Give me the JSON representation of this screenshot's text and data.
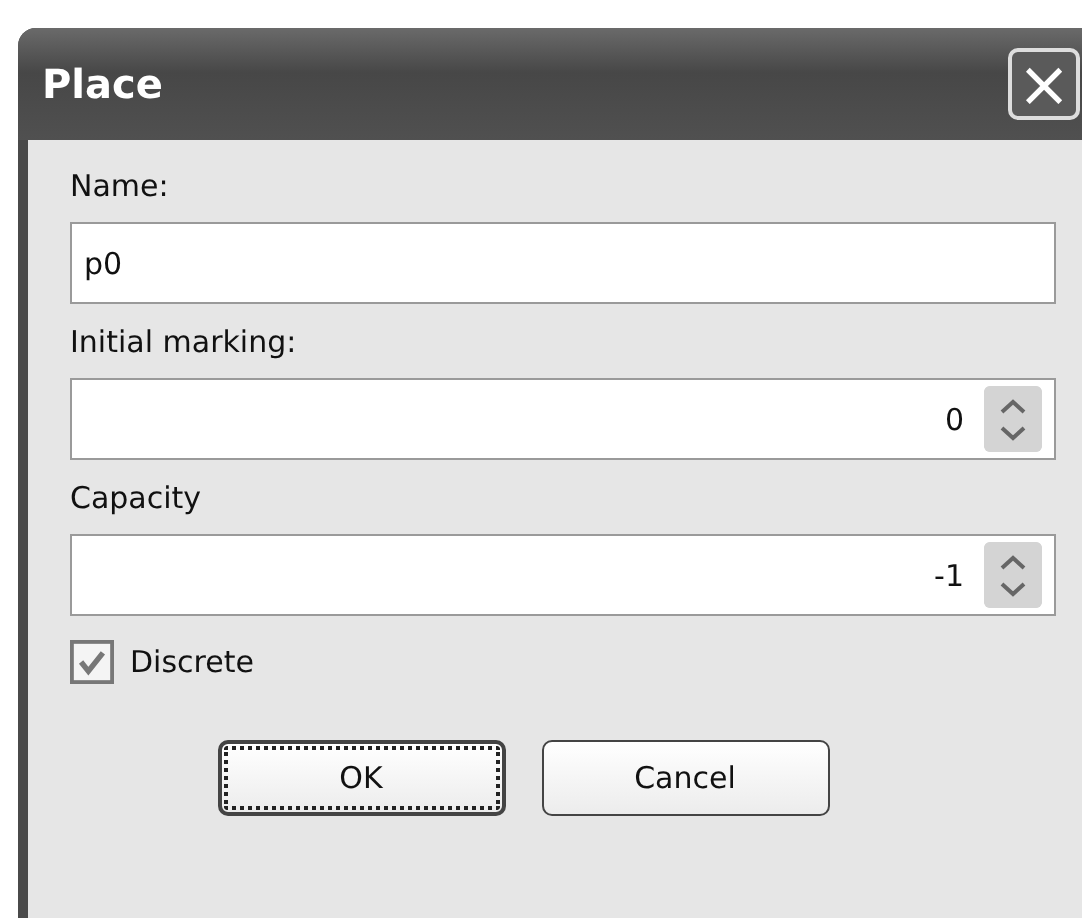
{
  "window": {
    "title": "Place",
    "close_icon": "×"
  },
  "fields": [
    {
      "kind": "text",
      "label": "Name:",
      "value": "p0"
    },
    {
      "kind": "spin",
      "label": "Initial marking:",
      "value": "0"
    },
    {
      "kind": "spin",
      "label": "Capacity",
      "value": "-1"
    }
  ],
  "checkbox": {
    "label": "Discrete",
    "checked": true
  },
  "buttons": [
    {
      "label": "OK",
      "focused": true
    },
    {
      "label": "Cancel",
      "focused": false
    }
  ]
}
